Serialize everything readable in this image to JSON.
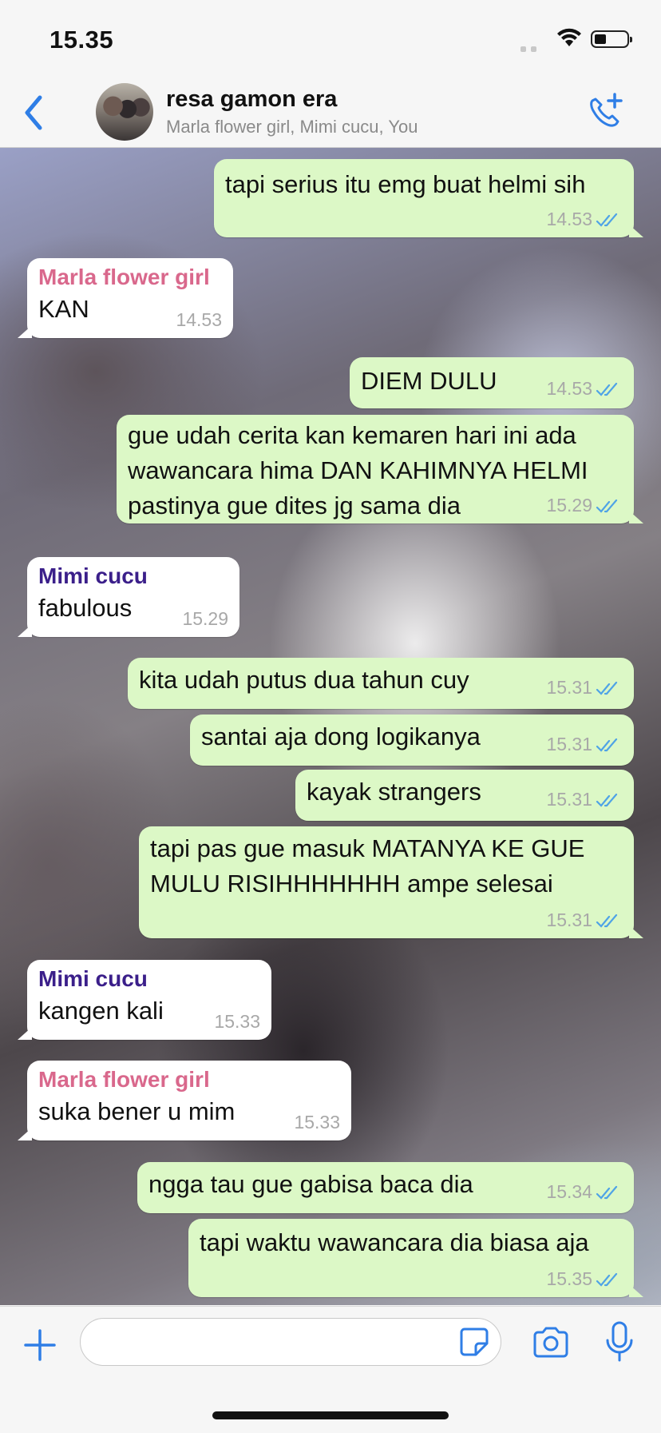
{
  "status_bar": {
    "time": "15.35"
  },
  "header": {
    "title": "resa gamon era",
    "subtitle": "Marla flower girl, Mimi cucu, You"
  },
  "colors": {
    "accent": "#2f7ee6",
    "outgoing_bubble": "#dcf8c6",
    "incoming_bubble": "#ffffff",
    "sender_marla": "#d9688c",
    "sender_mimi": "#3b1f8a",
    "read_ticks": "#4fa3e6"
  },
  "messages": [
    {
      "direction": "out",
      "lines": [
        "tapi serius itu emg buat helmi sih"
      ],
      "time": "14.53",
      "read": true
    },
    {
      "direction": "in",
      "sender": "Marla flower girl",
      "lines": [
        "KAN"
      ],
      "time": "14.53"
    },
    {
      "direction": "out",
      "lines": [
        "DIEM DULU"
      ],
      "time": "14.53",
      "read": true
    },
    {
      "direction": "out",
      "lines": [
        "gue udah cerita kan kemaren hari ini ada",
        "wawancara hima DAN KAHIMNYA HELMI",
        "pastinya gue dites jg sama dia"
      ],
      "time": "15.29",
      "read": true
    },
    {
      "direction": "in",
      "sender": "Mimi cucu",
      "lines": [
        "fabulous"
      ],
      "time": "15.29"
    },
    {
      "direction": "out",
      "lines": [
        "kita udah putus dua tahun cuy"
      ],
      "time": "15.31",
      "read": true
    },
    {
      "direction": "out",
      "lines": [
        "santai aja dong logikanya"
      ],
      "time": "15.31",
      "read": true
    },
    {
      "direction": "out",
      "lines": [
        "kayak strangers"
      ],
      "time": "15.31",
      "read": true
    },
    {
      "direction": "out",
      "lines": [
        "tapi pas gue masuk MATANYA KE GUE",
        "MULU RISIHHHHHHH ampe selesai"
      ],
      "time": "15.31",
      "read": true
    },
    {
      "direction": "in",
      "sender": "Mimi cucu",
      "lines": [
        "kangen kali"
      ],
      "time": "15.33"
    },
    {
      "direction": "in",
      "sender": "Marla flower girl",
      "lines": [
        "suka bener u mim"
      ],
      "time": "15.33"
    },
    {
      "direction": "out",
      "lines": [
        "ngga tau gue gabisa baca dia"
      ],
      "time": "15.34",
      "read": true
    },
    {
      "direction": "out",
      "lines": [
        "tapi waktu wawancara dia biasa aja"
      ],
      "time": "15.35",
      "read": true
    }
  ],
  "input": {
    "placeholder": ""
  },
  "icons": {
    "back": "chevron-left-icon",
    "call": "add-call-icon",
    "plus": "plus-icon",
    "sticker": "sticker-icon",
    "camera": "camera-icon",
    "mic": "microphone-icon"
  }
}
